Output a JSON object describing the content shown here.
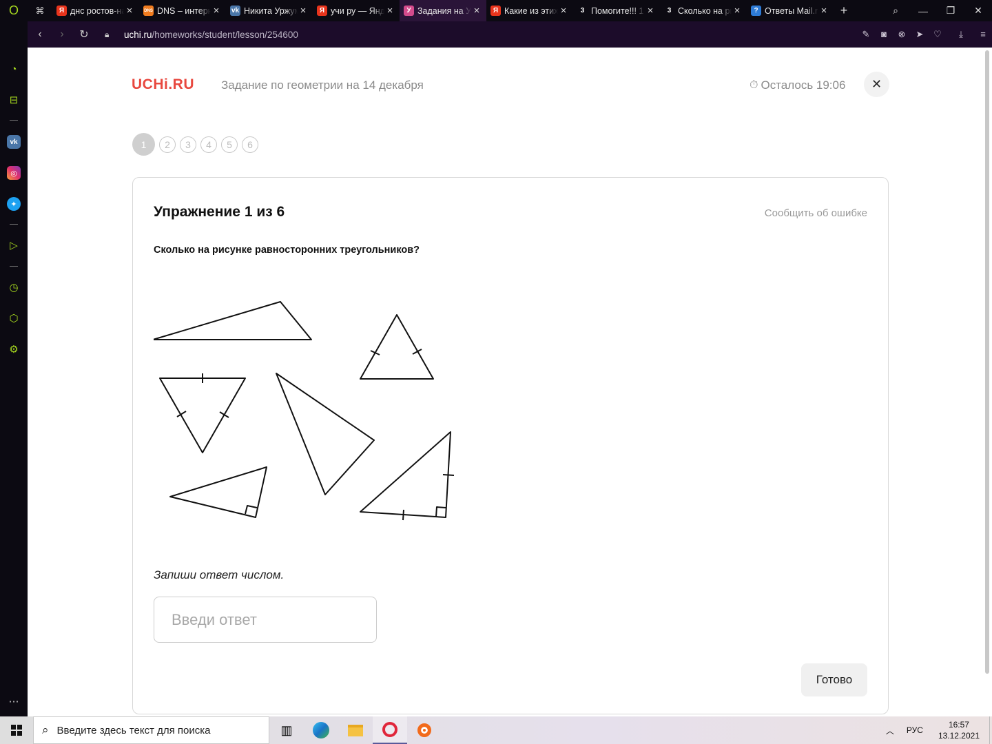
{
  "browser": {
    "tabs": [
      {
        "title": "днс ростов-на-дону",
        "icon": "yandex-icon",
        "color": "#e8341c",
        "glyph": "Я"
      },
      {
        "title": "DNS – интернет магазин",
        "icon": "dns-icon",
        "color": "#f17c1f",
        "glyph": "DNS"
      },
      {
        "title": "Никита Уржумов",
        "icon": "vk-icon",
        "color": "#4a76a8",
        "glyph": "vk"
      },
      {
        "title": "учи ру — Яндекс",
        "icon": "yandex-icon",
        "color": "#e8341c",
        "glyph": "Я"
      },
      {
        "title": "Задания на Учи.ру",
        "icon": "uchi-icon",
        "color": "#d34b8c",
        "glyph": "У"
      },
      {
        "title": "Какие из этих",
        "icon": "yandex-icon",
        "color": "#e8341c",
        "glyph": "Я"
      },
      {
        "title": "Помогите!!! 1",
        "icon": "znanija-icon",
        "color": "#0c0a12",
        "glyph": "3"
      },
      {
        "title": "Сколько на рисунке",
        "icon": "znanija-icon",
        "color": "#0c0a12",
        "glyph": "3"
      },
      {
        "title": "Ответы Mail.ru",
        "icon": "mailru-icon",
        "color": "#2e7bd6",
        "glyph": "?"
      }
    ],
    "active_tab_index": 4,
    "url_host": "uchi.ru",
    "url_path": "/homeworks/student/lesson/254600"
  },
  "page": {
    "logo": "UCHi.RU",
    "homework_title": "Задание по геометрии на 14 декабря",
    "timer_text": "Осталось 19:06",
    "steps": [
      "1",
      "2",
      "3",
      "4",
      "5",
      "6"
    ],
    "current_step": 1,
    "exercise_title": "Упражнение 1 из 6",
    "report_link": "Сообщить об ошибке",
    "question": "Сколько на рисунке равносторонних треугольников?",
    "instruction": "Запиши ответ числом.",
    "answer_placeholder": "Введи ответ",
    "answer_value": "",
    "done_button": "Готово"
  },
  "taskbar": {
    "search_placeholder": "Введите здесь текст для поиска",
    "language": "РУС",
    "time": "16:57",
    "date": "13.12.2021"
  },
  "colors": {
    "brand": "#e8483f",
    "browser_accent": "#a6d81f",
    "browser_bg": "#0c0a12",
    "addressbar_bg": "#1c0c2a"
  }
}
